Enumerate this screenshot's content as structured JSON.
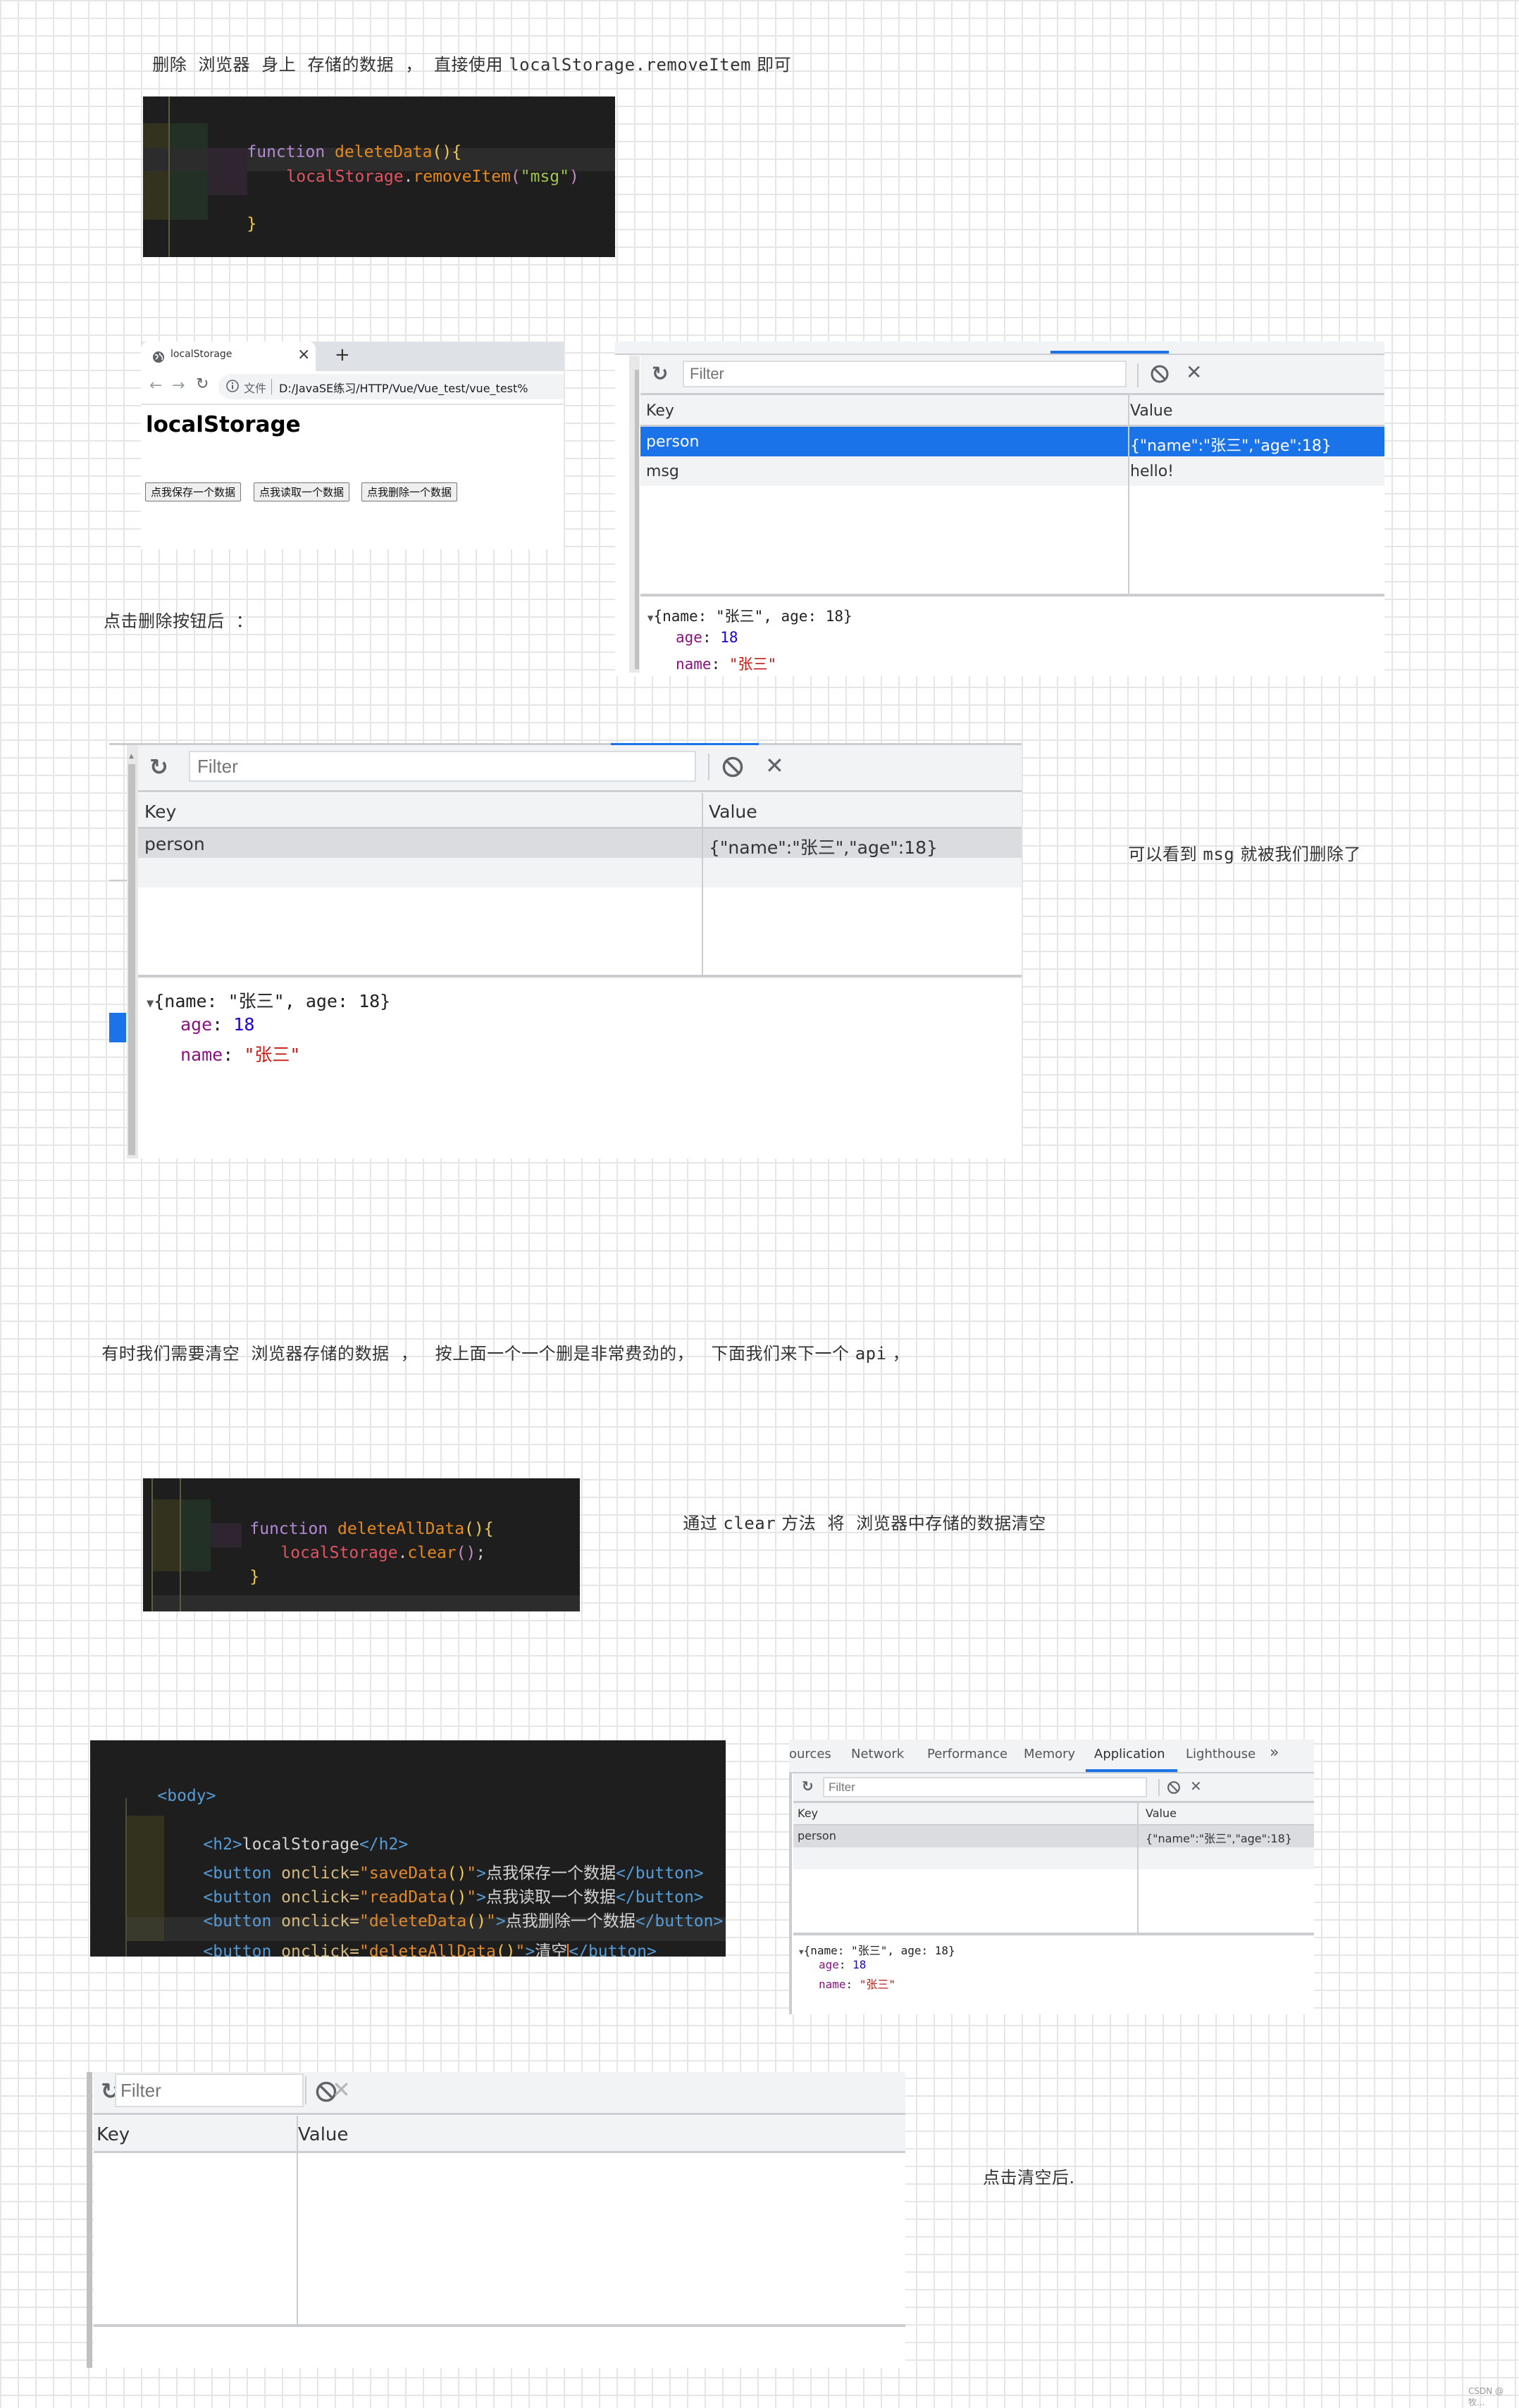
{
  "notes": {
    "intro": {
      "before": "删除  浏览器  身上  存储的数据  ，  直接使用 ",
      "code": "localStorage.removeItem",
      "after": " 即可"
    },
    "after_delete_click": "点击删除按钮后  ：",
    "msg_removed": {
      "before": "可以看到 ",
      "code": "msg",
      "after": " 就被我们删除了"
    },
    "clear_intro": {
      "before": "有时我们需要清空  浏览器存储的数据  ，   按上面一个一个删是非常费劲的，   下面我们来下一个 ",
      "code": "api",
      "after": " ，"
    },
    "clear_method": {
      "before": "通过 ",
      "code": "clear",
      "after": " 方法  将  浏览器中存储的数据清空"
    },
    "after_clear_click": "点击清空后.",
    "watermark": "CSDN @牧..."
  },
  "code_delete": {
    "line1": {
      "kw": "function",
      "fn": "deleteData",
      "paren": "()",
      "brace": "{"
    },
    "line2": {
      "obj": "localStorage",
      "dot": ".",
      "method": "removeItem",
      "open": "(",
      "arg": "\"msg\"",
      "close": ")"
    },
    "line3": {
      "brace": "}"
    }
  },
  "code_clear": {
    "line1": {
      "kw": "function",
      "fn": "deleteAllData",
      "paren": "()",
      "brace": "{"
    },
    "line2": {
      "obj": "localStorage",
      "dot": ".",
      "method": "clear",
      "open": "(",
      "close": ")",
      "semi": ";"
    },
    "line3": {
      "brace": "}"
    }
  },
  "code_html": {
    "body_open": "<body>",
    "h2": {
      "open": "<h2>",
      "text": "localStorage",
      "close": "</h2>"
    },
    "buttons": [
      {
        "handler": "saveData",
        "label": "点我保存一个数据"
      },
      {
        "handler": "readData",
        "label": "点我读取一个数据"
      },
      {
        "handler": "deleteData",
        "label": "点我删除一个数据"
      },
      {
        "handler": "deleteAllData",
        "label": "清空"
      }
    ],
    "button_open": "<button",
    "onclick_attr": " onclick=",
    "quote": "\"",
    "call_parens": "()",
    "tag_end": ">",
    "button_close": "</button>"
  },
  "browser": {
    "tab_title": "localStorage",
    "tab_close": "×",
    "new_tab": "+",
    "address_label": "文件",
    "address_url": "D:/JavaSE练习/HTTP/Vue/Vue_test/vue_test%",
    "page_heading": "localStorage",
    "buttons": [
      "点我保存一个数据",
      "点我读取一个数据",
      "点我删除一个数据"
    ]
  },
  "devtools": {
    "tabs": [
      "Sources",
      "Network",
      "Performance",
      "Memory",
      "Application",
      "Lighthouse"
    ],
    "tabs_partial": [
      "ources",
      "Network",
      "Performance",
      "Memory",
      "Application",
      "Lighthouse"
    ],
    "more_tabs": "»",
    "active_tab": "Application",
    "filter_placeholder": "Filter",
    "columns": {
      "key": "Key",
      "value": "Value"
    },
    "accent": "#1a73e8"
  },
  "storage_before": {
    "rows": [
      {
        "key": "person",
        "value": "{\"name\":\"张三\",\"age\":18}",
        "selected": true
      },
      {
        "key": "msg",
        "value": "hello!",
        "selected": false
      }
    ]
  },
  "storage_after_delete": {
    "rows": [
      {
        "key": "person",
        "value": "{\"name\":\"张三\",\"age\":18}",
        "selected": false
      }
    ]
  },
  "storage_after_clear": {
    "rows": []
  },
  "preview": {
    "summary": "{name: \"张三\", age: 18}",
    "toggle": "▼",
    "props": [
      {
        "key": "age",
        "sep": ": ",
        "value": "18",
        "type": "number"
      },
      {
        "key": "name",
        "sep": ": ",
        "value": "\"张三\"",
        "type": "string"
      }
    ]
  }
}
